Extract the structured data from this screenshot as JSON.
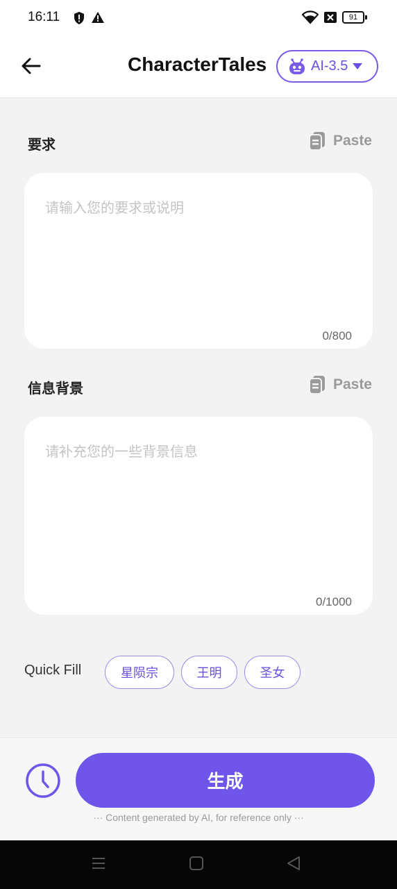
{
  "status_bar": {
    "time": "16:11",
    "battery": "91",
    "icons": [
      "shield-alert-icon",
      "warning-icon",
      "wifi-icon",
      "close-box-icon",
      "battery-icon"
    ]
  },
  "header": {
    "title": "CharacterTales",
    "back_icon": "arrow-left-icon",
    "model": {
      "label": "AI-3.5",
      "icon": "robot-icon",
      "caret_icon": "caret-down-icon"
    }
  },
  "requirements": {
    "label": "要求",
    "paste_label": "Paste",
    "paste_icon": "clipboard-icon",
    "placeholder": "请输入您的要求或说明",
    "counter": "0/800"
  },
  "background": {
    "label": "信息背景",
    "paste_label": "Paste",
    "paste_icon": "clipboard-icon",
    "placeholder": "请补充您的一些背景信息",
    "counter": "0/1000"
  },
  "quick_fill": {
    "label": "Quick Fill",
    "chips": [
      "星陨宗",
      "王明",
      "圣女"
    ]
  },
  "footer": {
    "history_icon": "clock-icon",
    "generate_label": "生成",
    "disclaimer": "··· Content generated by AI, for reference only ···"
  },
  "nav": {
    "icons": [
      "menu-icon",
      "home-square-icon",
      "back-triangle-icon"
    ]
  },
  "colors": {
    "accent": "#6f55e9",
    "accent_text": "#6b4fe0",
    "placeholder": "#c4c4c4",
    "background": "#f3f3f3"
  }
}
